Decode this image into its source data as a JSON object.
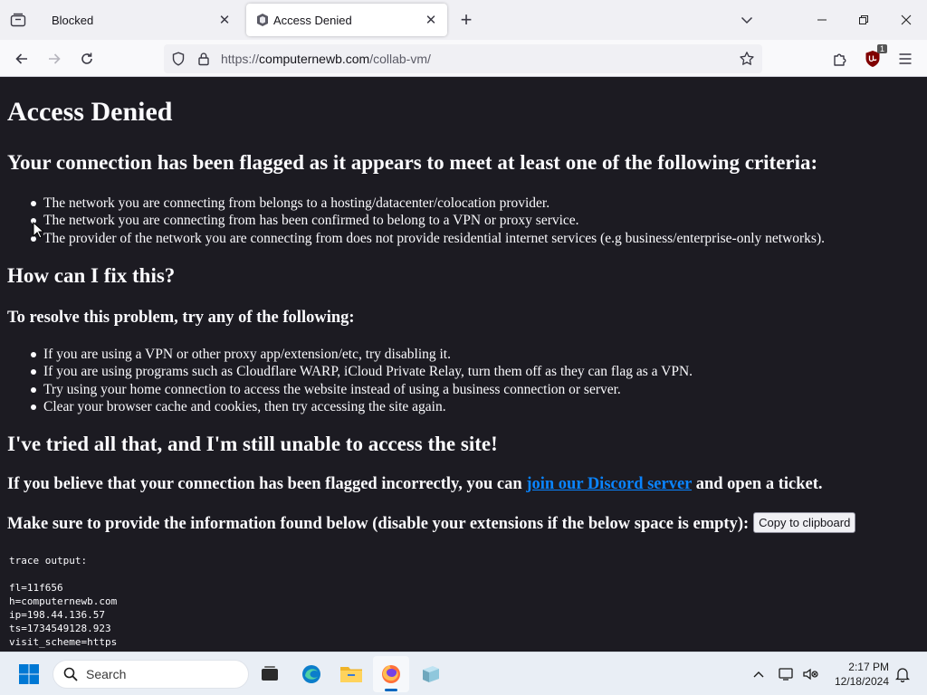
{
  "browser": {
    "tabs": [
      {
        "title": "Blocked",
        "active": false
      },
      {
        "title": "Access Denied",
        "active": true
      }
    ],
    "url": {
      "scheme": "https://",
      "host": "computernewb.com",
      "path": "/collab-vm/"
    },
    "ublock_badge": "1"
  },
  "page": {
    "title": "Access Denied",
    "criteria_heading": "Your connection has been flagged as it appears to meet at least one of the following criteria:",
    "criteria": [
      "The network you are connecting from belongs to a hosting/datacenter/colocation provider.",
      "The network you are connecting from has been confirmed to belong to a VPN or proxy service.",
      "The provider of the network you are connecting from does not provide residential internet services (e.g business/enterprise-only networks)."
    ],
    "fix_heading": "How can I fix this?",
    "resolve_heading": "To resolve this problem, try any of the following:",
    "fixes": [
      "If you are using a VPN or other proxy app/extension/etc, try disabling it.",
      "If you are using programs such as Cloudflare WARP, iCloud Private Relay, turn them off as they can flag as a VPN.",
      "Try using your home connection to access the website instead of using a business connection or server.",
      "Clear your browser cache and cookies, then try accessing the site again."
    ],
    "tried_heading": "I've tried all that, and I'm still unable to access the site!",
    "discord_prefix": "If you believe that your connection has been flagged incorrectly, you can",
    "discord_link": "join our Discord server",
    "discord_suffix": "and open a ticket.",
    "info_text": "Make sure to provide the information found below (disable your extensions if the below space is empty):",
    "copy_button": "Copy to clipboard",
    "trace": "trace output:\n\nfl=11f656\nh=computernewb.com\nip=198.44.136.57\nts=1734549128.923\nvisit_scheme=https"
  },
  "taskbar": {
    "search_placeholder": "Search",
    "time": "2:17 PM",
    "date": "12/18/2024"
  }
}
